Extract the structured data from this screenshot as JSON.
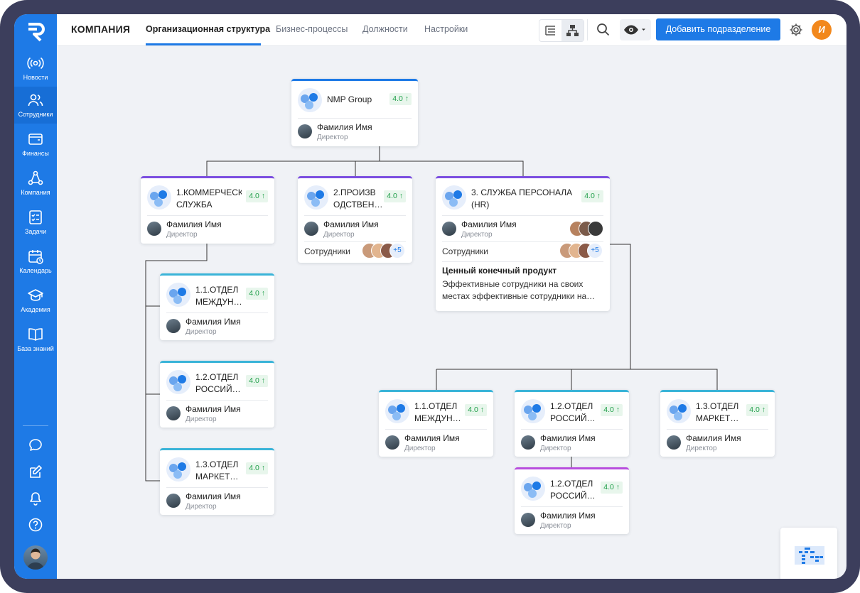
{
  "app": {
    "brand": "КОМПАНИЯ"
  },
  "tabs": [
    {
      "label": "Организационная структура",
      "active": true
    },
    {
      "label": "Бизнес-процессы"
    },
    {
      "label": "Должности"
    },
    {
      "label": "Настройки"
    }
  ],
  "toolbar": {
    "add_label": "Добавить подразделение",
    "user_initial": "И"
  },
  "sidebar": {
    "items": [
      {
        "label": "Новости",
        "icon": "radio-icon"
      },
      {
        "label": "Сотрудники",
        "icon": "people-icon",
        "active": true
      },
      {
        "label": "Финансы",
        "icon": "wallet-icon"
      },
      {
        "label": "Компания",
        "icon": "org-icon"
      },
      {
        "label": "Задачи",
        "icon": "checklist-icon"
      },
      {
        "label": "Календарь",
        "icon": "calendar-icon"
      },
      {
        "label": "Академия",
        "icon": "graduation-icon"
      },
      {
        "label": "База знаний",
        "icon": "book-icon"
      }
    ],
    "bottom_icons": [
      "chat-icon",
      "edit-icon",
      "bell-icon",
      "help-icon"
    ]
  },
  "common": {
    "name": "Фамилия Имя",
    "role": "Директор",
    "employees": "Сотрудники",
    "score": "4.0 ↑",
    "plus": "+5"
  },
  "cards": {
    "root": {
      "title": "NMP Group"
    },
    "c1": {
      "title": "1.КОММЕРЧЕСКАЯ СЛУЖБА"
    },
    "c2": {
      "title": "2.ПРОИЗВ ОДСТВЕН…"
    },
    "c3": {
      "title": "3. СЛУЖБА ПЕРСОНАЛА (HR)",
      "product_title": "Ценный конечный продукт",
      "product_desc": "Эффективные сотрудники на своих местах эффективные сотрудники на…"
    },
    "c11": {
      "title": "1.1.ОТДЕЛ МЕЖДУН…"
    },
    "c12": {
      "title": "1.2.ОТДЕЛ РОССИЙ…"
    },
    "c13": {
      "title": "1.3.ОТДЕЛ МАРКЕТ…"
    },
    "h11": {
      "title": "1.1.ОТДЕЛ МЕЖДУН…"
    },
    "h12": {
      "title": "1.2.ОТДЕЛ РОССИЙ…"
    },
    "h13": {
      "title": "1.3.ОТДЕЛ МАРКЕТ…"
    },
    "h121": {
      "title": "1.2.ОТДЕЛ РОССИЙ…"
    }
  }
}
